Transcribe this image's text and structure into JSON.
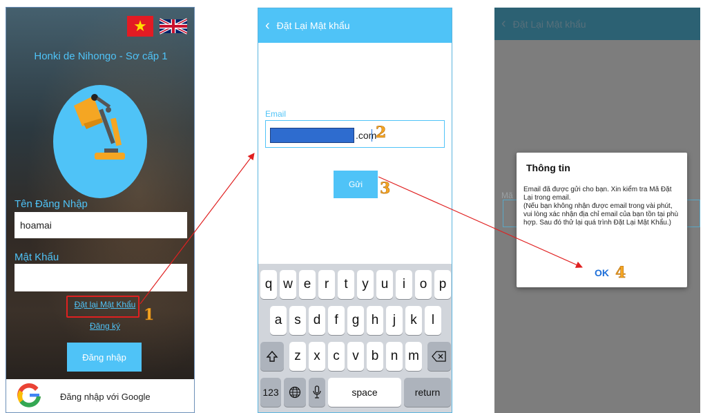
{
  "screen1": {
    "app_title": "Honki de Nihongo - Sơ cấp 1",
    "username_label": "Tên Đăng Nhập",
    "username_value": "hoamai",
    "password_label": "Mật Khẩu",
    "password_value": "",
    "reset_link": "Đặt lại Mật Khẩu",
    "register_link": "Đăng ký",
    "login_button": "Đăng nhập",
    "google_button": "Đăng nhập với Google",
    "accent_color": "#4fc3f7"
  },
  "screen2": {
    "header_title": "Đặt Lại Mật khẩu",
    "back_icon": "‹",
    "email_label": "Email",
    "email_visible_suffix": ".com",
    "send_button": "Gửi",
    "keyboard": {
      "row1": [
        "q",
        "w",
        "e",
        "r",
        "t",
        "y",
        "u",
        "i",
        "o",
        "p"
      ],
      "row2": [
        "a",
        "s",
        "d",
        "f",
        "g",
        "h",
        "j",
        "k",
        "l"
      ],
      "row3": [
        "z",
        "x",
        "c",
        "v",
        "b",
        "n",
        "m"
      ],
      "numbers_key": "123",
      "space_key": "space",
      "return_key": "return"
    }
  },
  "screen3": {
    "header_title": "Đặt Lại Mật khẩu",
    "back_icon": "‹",
    "behind_label": "Mã",
    "dialog_title": "Thông tin",
    "dialog_line1": "Email đã được gửi cho bạn. Xin kiểm tra Mã Đặt Lại trong email.",
    "dialog_line2": "(Nếu bạn không nhận được email trong vài phút, vui lòng xác nhận địa chỉ email của bạn tồn tại phù hợp. Sau đó thử lại quá trình Đặt Lại Mật Khẩu.)",
    "ok_button": "OK"
  },
  "steps": [
    "1",
    "2",
    "3",
    "4"
  ],
  "annotation_color": "#e02020",
  "step_number_color": "#f5a623"
}
